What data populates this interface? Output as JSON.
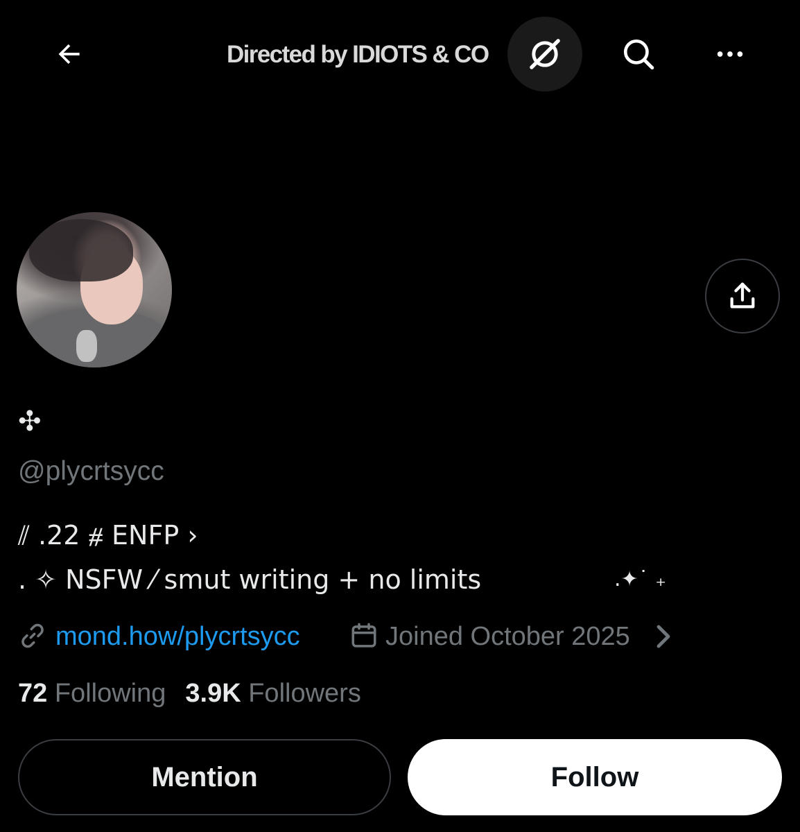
{
  "header": {
    "title": "Directed by IDIOTS & CO",
    "back_icon": "back-arrow-icon",
    "grok_icon": "grok-icon",
    "search_icon": "search-icon",
    "more_icon": "more-icon"
  },
  "profile": {
    "display_name": "✣",
    "handle": "@plycrtsycc",
    "bio_line1": "⫽ .22 ⧣ ENFP ›",
    "bio_line2": ". ✧ NSFW ⁄ smut writing + no limits",
    "bio_sparkle": ".✦˙ ₊",
    "website": "mond.how/plycrtsycc",
    "joined": "Joined October 2025",
    "following_count": "72",
    "following_label": "Following",
    "followers_count": "3.9K",
    "followers_label": "Followers"
  },
  "actions": {
    "mention_label": "Mention",
    "follow_label": "Follow"
  },
  "colors": {
    "background": "#000000",
    "primary_text": "#e7e9ea",
    "secondary_text": "#71767b",
    "link": "#1d9bf0",
    "border": "#3a3d41"
  }
}
